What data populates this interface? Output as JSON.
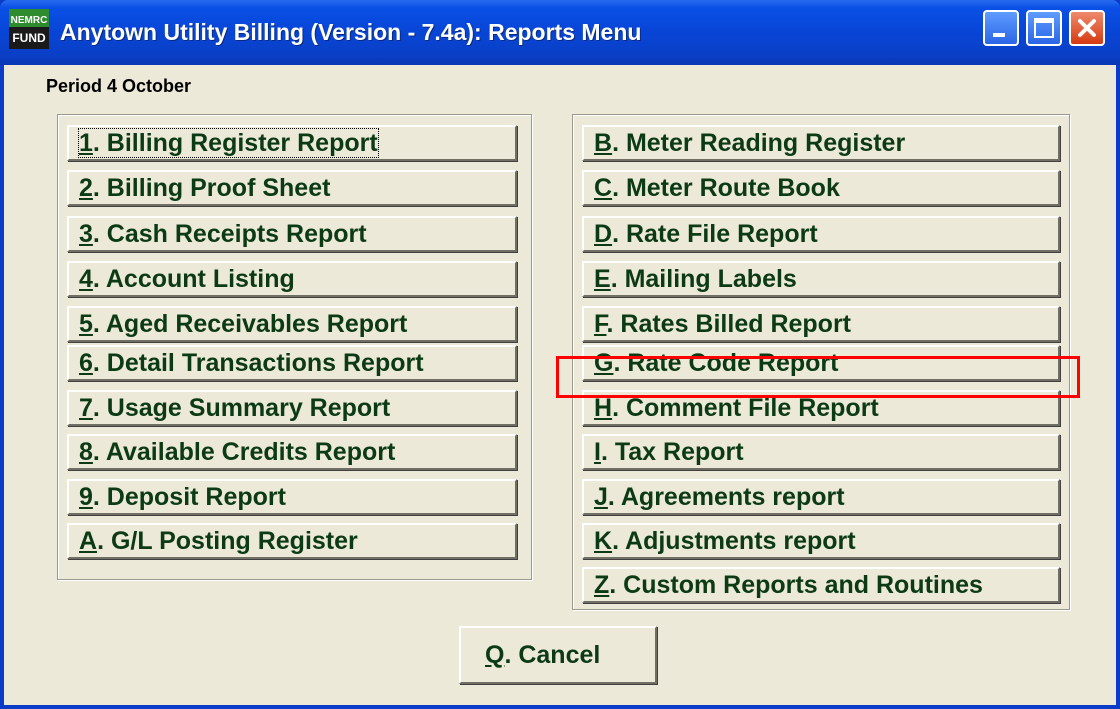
{
  "window": {
    "title": "Anytown Utility Billing (Version - 7.4a):  Reports Menu",
    "app_icon_text_top": "NEMRC",
    "app_icon_text_bottom": "FUND",
    "controls": [
      "minimize-icon",
      "maximize-icon",
      "close-icon"
    ]
  },
  "period_label": "Period 4 October",
  "left_buttons": [
    {
      "key": "1",
      "label": ". Billing Register Report"
    },
    {
      "key": "2",
      "label": ".  Billing Proof Sheet"
    },
    {
      "key": "3",
      "label": ". Cash Receipts Report"
    },
    {
      "key": "4",
      "label": ". Account Listing"
    },
    {
      "key": "5",
      "label": ". Aged Receivables Report"
    },
    {
      "key": "6",
      "label": ". Detail Transactions Report"
    },
    {
      "key": "7",
      "label": ". Usage Summary Report"
    },
    {
      "key": "8",
      "label": ". Available Credits Report"
    },
    {
      "key": "9",
      "label": ".  Deposit Report"
    },
    {
      "key": "A",
      "label": ". G/L Posting Register"
    }
  ],
  "right_buttons": [
    {
      "key": "B",
      "label": ". Meter Reading Register"
    },
    {
      "key": "C",
      "label": ". Meter Route Book"
    },
    {
      "key": "D",
      "label": ". Rate File Report"
    },
    {
      "key": "E",
      "label": ". Mailing Labels"
    },
    {
      "key": "F",
      "label": ". Rates Billed Report"
    },
    {
      "key": "G",
      "label": ". Rate Code Report"
    },
    {
      "key": "H",
      "label": ". Comment File Report"
    },
    {
      "key": "I",
      "label": ". Tax Report"
    },
    {
      "key": "J",
      "label": ". Agreements report"
    },
    {
      "key": "K",
      "label": ". Adjustments report"
    },
    {
      "key": "Z",
      "label": ".  Custom Reports and Routines"
    }
  ],
  "cancel_button": {
    "key": "Q",
    "label": ". Cancel"
  },
  "colors": {
    "title_bar": "#0a50e6",
    "face": "#ece9d8",
    "button_text": "#0b3a15",
    "highlight": "#ff0000"
  }
}
